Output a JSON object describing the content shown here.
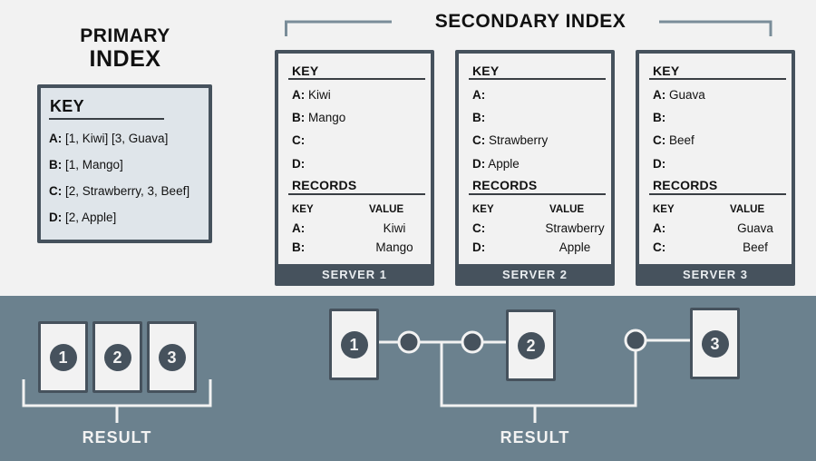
{
  "primary_index": {
    "title_line1": "PRIMARY",
    "title_line2": "INDEX",
    "key_heading": "KEY",
    "rows": [
      {
        "key": "A:",
        "value": "[1, Kiwi] [3, Guava]"
      },
      {
        "key": "B:",
        "value": "[1, Mango]"
      },
      {
        "key": "C:",
        "value": "[2, Strawberry, 3, Beef]"
      },
      {
        "key": "D:",
        "value": "[2, Apple]"
      }
    ]
  },
  "secondary_index": {
    "title": "SECONDARY INDEX",
    "servers": [
      {
        "name": "SERVER 1",
        "key_heading": "KEY",
        "keys": [
          {
            "key": "A:",
            "value": "Kiwi"
          },
          {
            "key": "B:",
            "value": "Mango"
          },
          {
            "key": "C:",
            "value": ""
          },
          {
            "key": "D:",
            "value": ""
          }
        ],
        "records_heading": "RECORDS",
        "col_key": "KEY",
        "col_value": "VALUE",
        "records": [
          {
            "key": "A:",
            "value": "Kiwi"
          },
          {
            "key": "B:",
            "value": "Mango"
          }
        ]
      },
      {
        "name": "SERVER 2",
        "key_heading": "KEY",
        "keys": [
          {
            "key": "A:",
            "value": ""
          },
          {
            "key": "B:",
            "value": ""
          },
          {
            "key": "C:",
            "value": "Strawberry"
          },
          {
            "key": "D:",
            "value": "Apple"
          }
        ],
        "records_heading": "RECORDS",
        "col_key": "KEY",
        "col_value": "VALUE",
        "records": [
          {
            "key": "C:",
            "value": "Strawberry"
          },
          {
            "key": "D:",
            "value": "Apple"
          }
        ]
      },
      {
        "name": "SERVER 3",
        "key_heading": "KEY",
        "keys": [
          {
            "key": "A:",
            "value": "Guava"
          },
          {
            "key": "B:",
            "value": ""
          },
          {
            "key": "C:",
            "value": "Beef"
          },
          {
            "key": "D:",
            "value": ""
          }
        ],
        "records_heading": "RECORDS",
        "col_key": "KEY",
        "col_value": "VALUE",
        "records": [
          {
            "key": "A:",
            "value": "Guava"
          },
          {
            "key": "C:",
            "value": "Beef"
          }
        ]
      }
    ]
  },
  "primary_result": {
    "cards": [
      "1",
      "2",
      "3"
    ],
    "label": "RESULT"
  },
  "secondary_result": {
    "cards": [
      "1",
      "2",
      "3"
    ],
    "label": "RESULT"
  },
  "colors": {
    "background": "#f2f2f2",
    "band": "#6b818e",
    "dark_slate": "#46525d",
    "primary_box_fill": "#dfe5ea",
    "bracket_gray": "#7a8d99"
  }
}
